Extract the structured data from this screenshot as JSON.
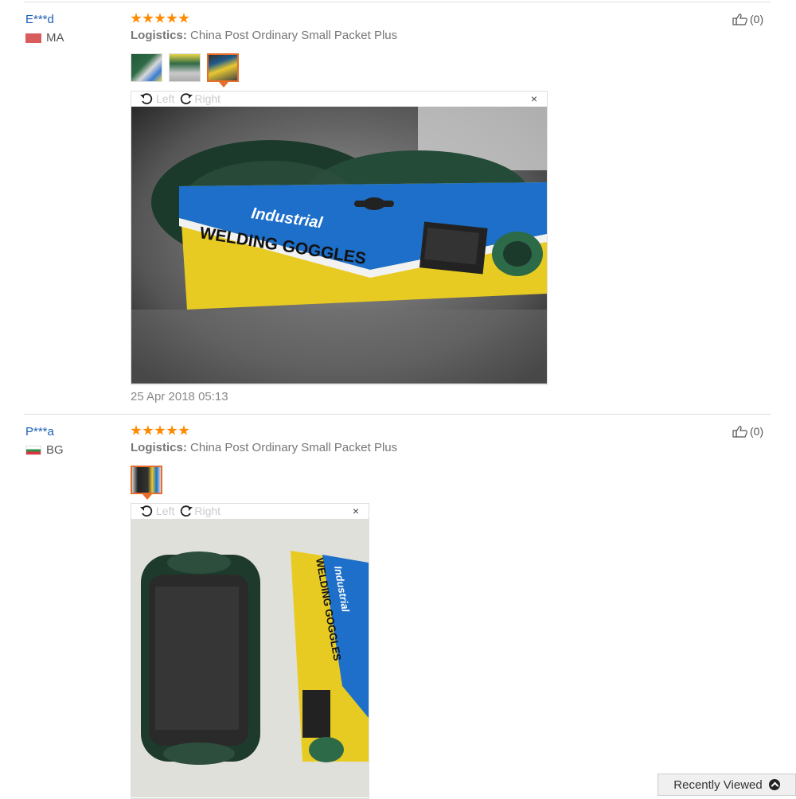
{
  "reviews": [
    {
      "user": "E***d",
      "country": "MA",
      "logistics_label": "Logistics:",
      "logistics_value": "China Post Ordinary Small Packet Plus",
      "helpful_count": "(0)",
      "rating": 5,
      "rotate_left": "Left",
      "rotate_right": "Right",
      "close": "×",
      "date": "25 Apr 2018 05:13",
      "photo": {
        "package_brand": "Industrial",
        "package_title": "WELDING GOGGLES"
      }
    },
    {
      "user": "P***a",
      "country": "BG",
      "logistics_label": "Logistics:",
      "logistics_value": "China Post Ordinary Small Packet Plus",
      "helpful_count": "(0)",
      "rating": 5,
      "rotate_left": "Left",
      "rotate_right": "Right",
      "close": "×",
      "photo": {
        "package_brand": "Industrial",
        "package_title": "WELDING GOGGLES"
      }
    }
  ],
  "recently_viewed": "Recently Viewed",
  "colors": {
    "star": "#ff8a00",
    "user_link": "#1a5fb4",
    "active_thumb": "#e76d2b"
  }
}
